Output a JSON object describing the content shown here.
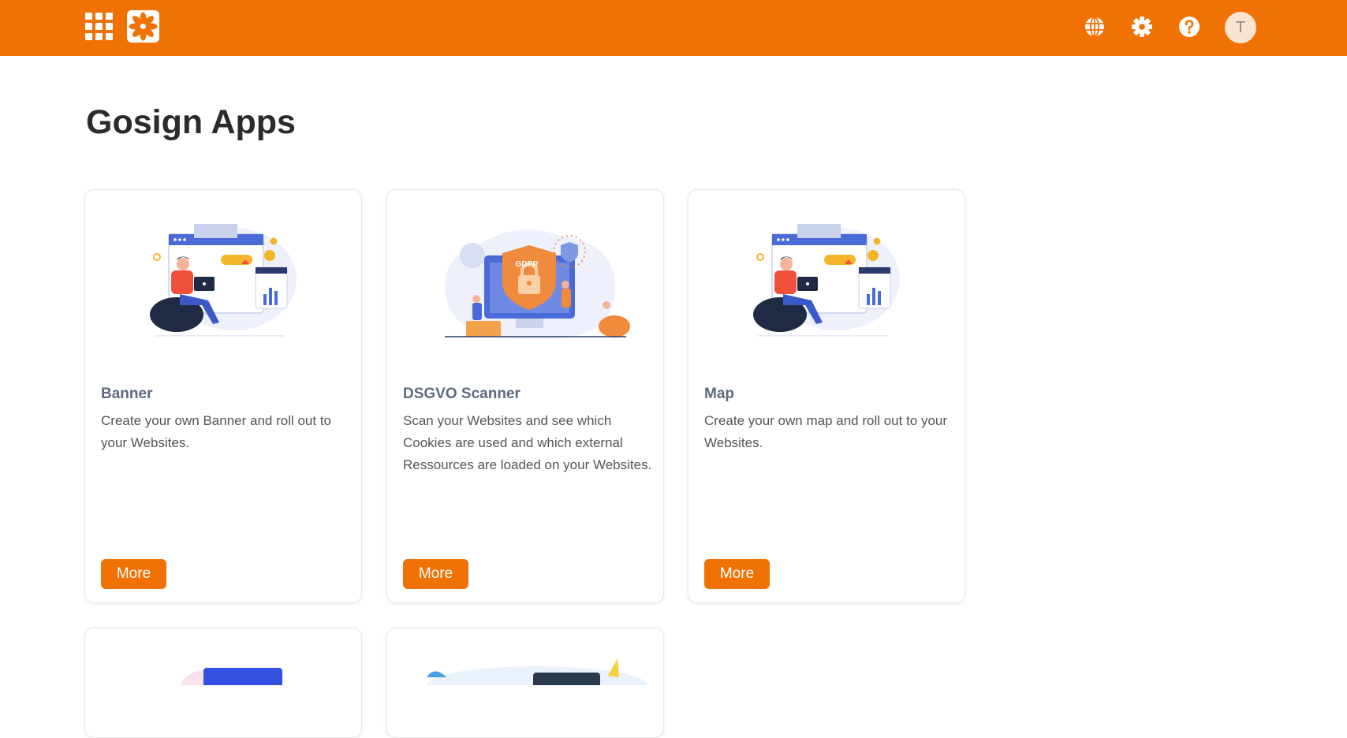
{
  "header": {
    "apps_icon": "grid-icon",
    "logo_icon": "flower-logo-icon",
    "language_icon": "globe-icon",
    "settings_icon": "gear-icon",
    "help_icon": "question-icon",
    "avatar_initial": "T",
    "brand_color": "#f07104"
  },
  "page": {
    "title": "Gosign Apps"
  },
  "cards": [
    {
      "title": "Banner",
      "description": "Create your own Banner and roll out to your Websites.",
      "button": "More",
      "illustration": "banner-illustration"
    },
    {
      "title": "DSGVO Scanner",
      "description": "Scan your Websites and see which Cookies are used and which external Ressources are loaded on your Websites.",
      "button": "More",
      "illustration": "gdpr-illustration",
      "badge": "GDPR"
    },
    {
      "title": "Map",
      "description": "Create your own map and roll out to your Websites.",
      "button": "More",
      "illustration": "map-illustration"
    }
  ]
}
